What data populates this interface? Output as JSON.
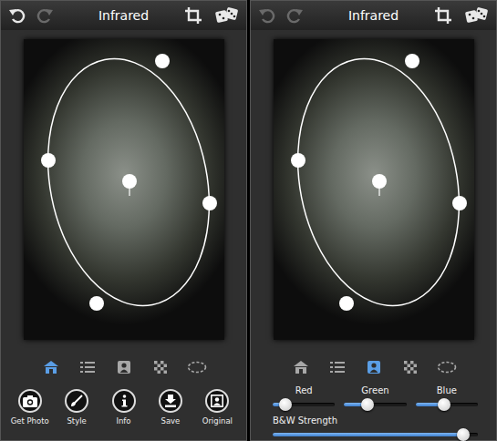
{
  "screens": [
    {
      "title": "Infrared",
      "undo": {
        "disabled": false
      },
      "redo": {
        "disabled": true
      },
      "tabs": [
        {
          "kind": "home",
          "selected": true
        },
        {
          "kind": "list",
          "selected": false
        },
        {
          "kind": "portrait",
          "selected": false
        },
        {
          "kind": "checker",
          "selected": false
        },
        {
          "kind": "ellipse",
          "selected": false
        }
      ],
      "panel": "buttons",
      "buttons": [
        {
          "label": "Get Photo",
          "kind": "camera"
        },
        {
          "label": "Style",
          "kind": "brush"
        },
        {
          "label": "Info",
          "kind": "info"
        },
        {
          "label": "Save",
          "kind": "save"
        },
        {
          "label": "Original",
          "kind": "original"
        }
      ],
      "sliders": [],
      "strength": null
    },
    {
      "title": "Infrared",
      "undo": {
        "disabled": true
      },
      "redo": {
        "disabled": true
      },
      "tabs": [
        {
          "kind": "home",
          "selected": false
        },
        {
          "kind": "list",
          "selected": false
        },
        {
          "kind": "portrait",
          "selected": true
        },
        {
          "kind": "checker",
          "selected": false
        },
        {
          "kind": "ellipse",
          "selected": false
        }
      ],
      "panel": "sliders",
      "buttons": [],
      "sliders": [
        {
          "label": "Red",
          "level": 0.2
        },
        {
          "label": "Green",
          "level": 0.37
        },
        {
          "label": "Blue",
          "level": 0.46
        }
      ],
      "strength": {
        "label": "B&W Strength",
        "level": 0.93
      }
    }
  ]
}
